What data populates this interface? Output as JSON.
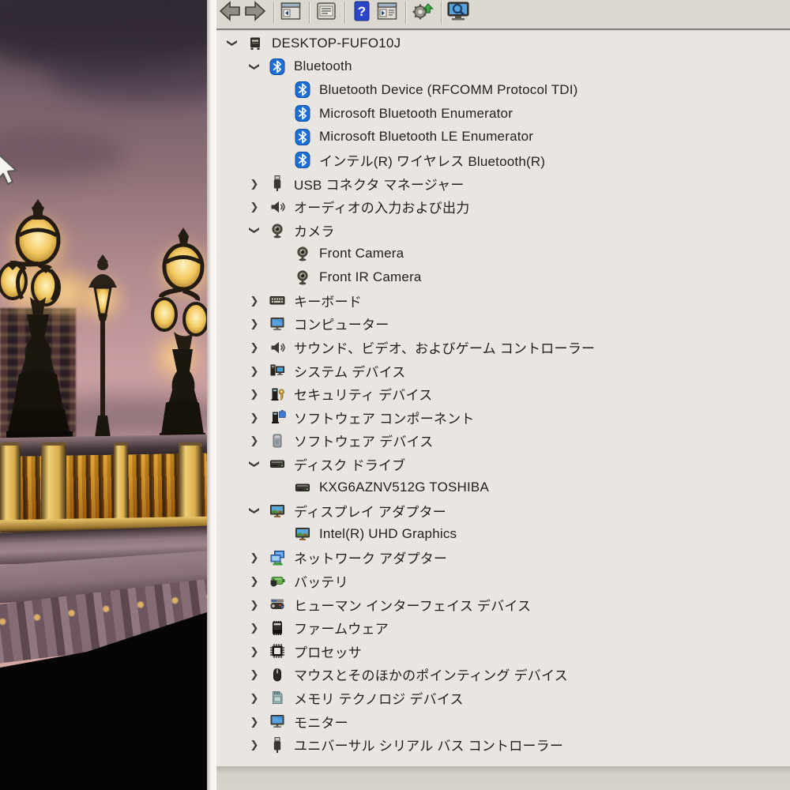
{
  "device_name": "DESKTOP-FUFO10J",
  "colors": {
    "pane_bg": "#e9e6e1",
    "toolbar_bg": "#dbd8d2",
    "text": "#211f1c",
    "bluetooth_blue": "#1e6fd4",
    "help_blue": "#2c46c8",
    "sky_pink": "#d4a7a7",
    "lamp_gold": "#e9c568"
  },
  "toolbar": {
    "items": [
      {
        "type": "button",
        "name": "back-button",
        "icon": "arrow-left-icon"
      },
      {
        "type": "button",
        "name": "forward-button",
        "icon": "arrow-right-icon"
      },
      {
        "type": "separator"
      },
      {
        "type": "button",
        "name": "show-console-tree-button",
        "icon": "window-back-icon"
      },
      {
        "type": "separator"
      },
      {
        "type": "button",
        "name": "properties-button",
        "icon": "properties-icon"
      },
      {
        "type": "separator"
      },
      {
        "type": "button",
        "name": "help-button",
        "icon": "help-icon"
      },
      {
        "type": "button",
        "name": "show-action-pane-button",
        "icon": "window-forward-icon"
      },
      {
        "type": "separator"
      },
      {
        "type": "button",
        "name": "update-driver-button",
        "icon": "update-driver-icon"
      },
      {
        "type": "separator"
      },
      {
        "type": "button",
        "name": "scan-hardware-changes-button",
        "icon": "scan-hardware-icon"
      }
    ]
  },
  "tree": {
    "items": [
      {
        "label": "DESKTOP-FUFO10J",
        "level": 0,
        "state": "expanded",
        "icon": "computer-root-icon"
      },
      {
        "label": "Bluetooth",
        "level": 1,
        "state": "expanded",
        "icon": "bluetooth-icon"
      },
      {
        "label": "Bluetooth Device (RFCOMM Protocol TDI)",
        "level": 2,
        "state": "none",
        "icon": "bluetooth-icon"
      },
      {
        "label": "Microsoft Bluetooth Enumerator",
        "level": 2,
        "state": "none",
        "icon": "bluetooth-icon"
      },
      {
        "label": "Microsoft Bluetooth LE Enumerator",
        "level": 2,
        "state": "none",
        "icon": "bluetooth-icon"
      },
      {
        "label": "インテル(R) ワイヤレス Bluetooth(R)",
        "level": 2,
        "state": "none",
        "icon": "bluetooth-icon"
      },
      {
        "label": "USB コネクタ マネージャー",
        "level": 1,
        "state": "collapsed",
        "icon": "usb-icon"
      },
      {
        "label": "オーディオの入力および出力",
        "level": 1,
        "state": "collapsed",
        "icon": "speaker-icon"
      },
      {
        "label": "カメラ",
        "level": 1,
        "state": "expanded",
        "icon": "camera-icon"
      },
      {
        "label": "Front Camera",
        "level": 2,
        "state": "none",
        "icon": "camera-icon"
      },
      {
        "label": "Front IR Camera",
        "level": 2,
        "state": "none",
        "icon": "camera-icon"
      },
      {
        "label": "キーボード",
        "level": 1,
        "state": "collapsed",
        "icon": "keyboard-icon"
      },
      {
        "label": "コンピューター",
        "level": 1,
        "state": "collapsed",
        "icon": "monitor-icon"
      },
      {
        "label": "サウンド、ビデオ、およびゲーム コントローラー",
        "level": 1,
        "state": "collapsed",
        "icon": "speaker-icon"
      },
      {
        "label": "システム デバイス",
        "level": 1,
        "state": "collapsed",
        "icon": "system-devices-icon"
      },
      {
        "label": "セキュリティ デバイス",
        "level": 1,
        "state": "collapsed",
        "icon": "security-device-icon"
      },
      {
        "label": "ソフトウェア コンポーネント",
        "level": 1,
        "state": "collapsed",
        "icon": "software-component-icon"
      },
      {
        "label": "ソフトウェア デバイス",
        "level": 1,
        "state": "collapsed",
        "icon": "software-device-icon"
      },
      {
        "label": "ディスク ドライブ",
        "level": 1,
        "state": "expanded",
        "icon": "disk-drive-icon"
      },
      {
        "label": "KXG6AZNV512G TOSHIBA",
        "level": 2,
        "state": "none",
        "icon": "disk-drive-icon"
      },
      {
        "label": "ディスプレイ アダプター",
        "level": 1,
        "state": "expanded",
        "icon": "display-adapter-icon"
      },
      {
        "label": "Intel(R) UHD Graphics",
        "level": 2,
        "state": "none",
        "icon": "display-adapter-icon"
      },
      {
        "label": "ネットワーク アダプター",
        "level": 1,
        "state": "collapsed",
        "icon": "network-adapter-icon"
      },
      {
        "label": "バッテリ",
        "level": 1,
        "state": "collapsed",
        "icon": "battery-icon"
      },
      {
        "label": "ヒューマン インターフェイス デバイス",
        "level": 1,
        "state": "collapsed",
        "icon": "hid-icon"
      },
      {
        "label": "ファームウェア",
        "level": 1,
        "state": "collapsed",
        "icon": "firmware-icon"
      },
      {
        "label": "プロセッサ",
        "level": 1,
        "state": "collapsed",
        "icon": "processor-icon"
      },
      {
        "label": "マウスとそのほかのポインティング デバイス",
        "level": 1,
        "state": "collapsed",
        "icon": "mouse-icon"
      },
      {
        "label": "メモリ テクノロジ デバイス",
        "level": 1,
        "state": "collapsed",
        "icon": "memory-tech-icon"
      },
      {
        "label": "モニター",
        "level": 1,
        "state": "collapsed",
        "icon": "monitor-icon"
      },
      {
        "label": "ユニバーサル シリアル バス コントローラー",
        "level": 1,
        "state": "collapsed",
        "icon": "usb-icon"
      }
    ]
  }
}
